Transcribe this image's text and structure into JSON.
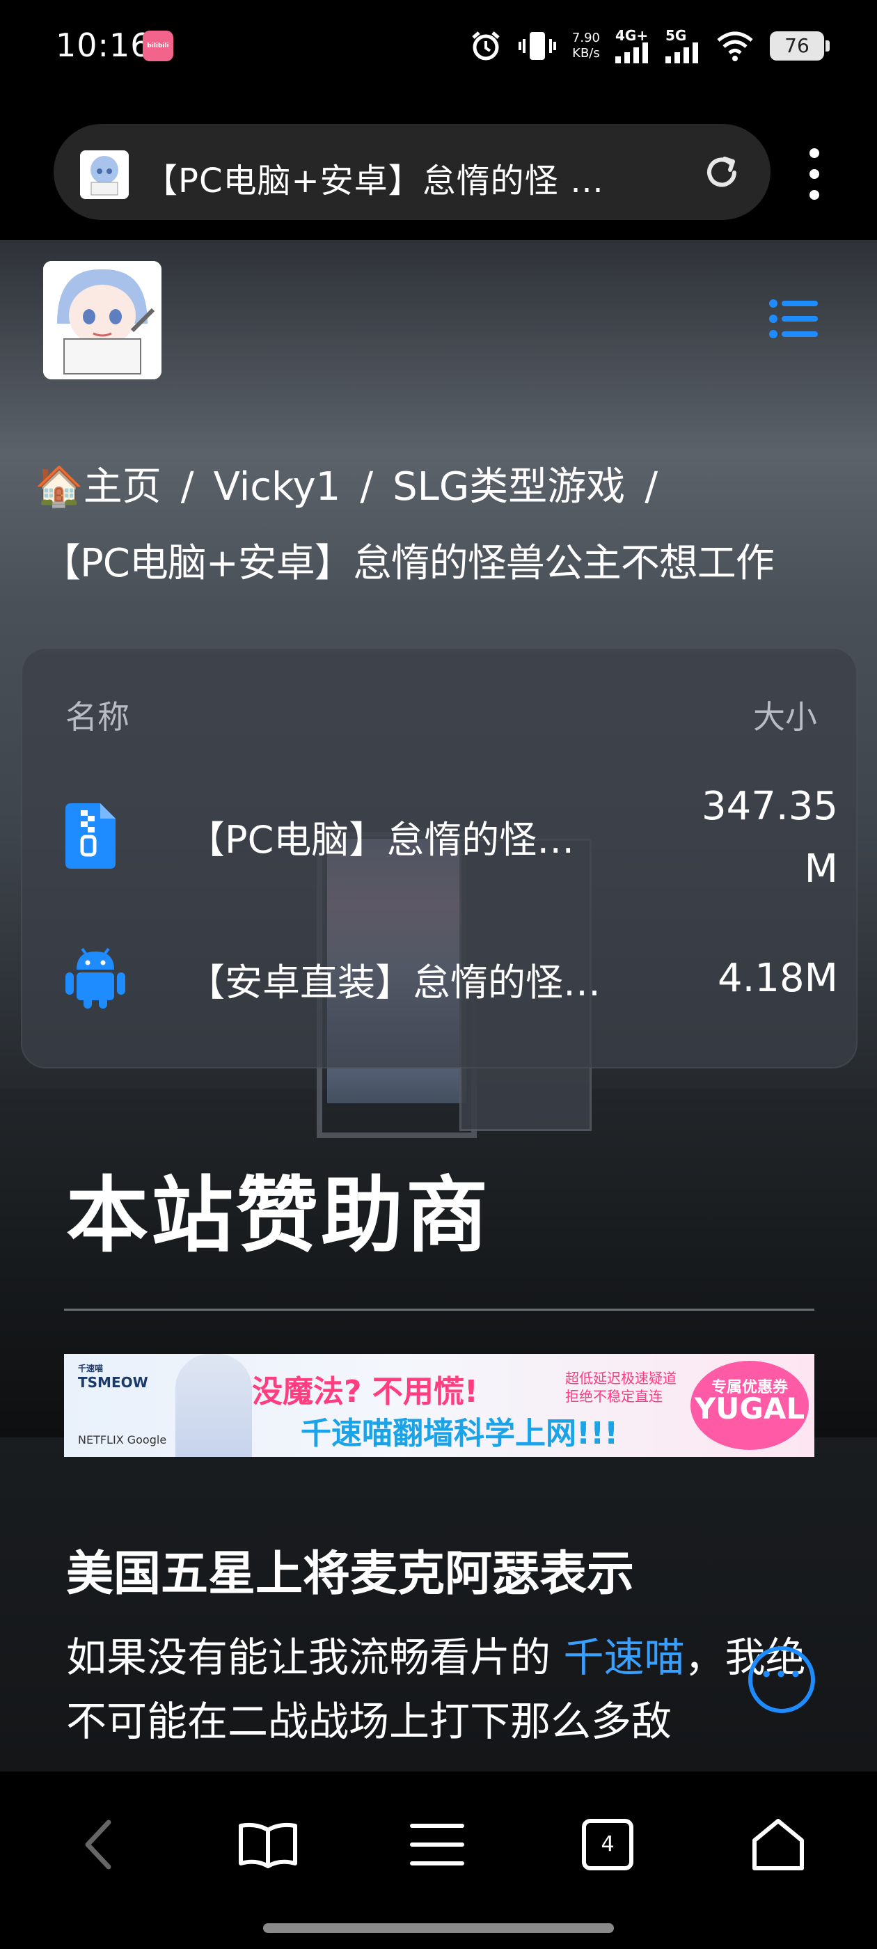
{
  "status": {
    "time": "10:16",
    "app_badge": "bilibili",
    "net_speed_value": "7.90",
    "net_speed_unit": "KB/s",
    "signal1": "4G+",
    "signal2": "5G",
    "battery": "76"
  },
  "browser": {
    "tab_title": "【PC电脑+安卓】怠惰的怪 …"
  },
  "breadcrumb": {
    "home": "主页",
    "items": [
      "Vicky1",
      "SLG类型游戏"
    ],
    "current": "【PC电脑+安卓】怠惰的怪兽公主不想工作"
  },
  "files": {
    "col_name": "名称",
    "col_size": "大小",
    "rows": [
      {
        "name": "【PC电脑】怠惰的怪…",
        "size_line1": "347.35",
        "size_line2": "M",
        "icon": "zip-file-icon"
      },
      {
        "name": "【安卓直装】怠惰的怪…",
        "size_line1": "4.18M",
        "size_line2": "",
        "icon": "android-icon"
      }
    ]
  },
  "sponsor": {
    "title": "本站赞助商",
    "banner": {
      "brand_small": "千速喵",
      "brand": "TSMEOW",
      "main": "没魔法? 不用慌!",
      "sub": "千速喵翻墙科学上网!!!",
      "side_line1": "超低延迟极速疑道",
      "side_line2": "拒绝不稳定直连",
      "badge_top": "专属优惠券",
      "badge_main": "YUGAL",
      "logos": "NETFLIX Google"
    }
  },
  "article": {
    "heading": "美国五星上将麦克阿瑟表示",
    "text_before": "如果没有能让我流畅看片的 ",
    "link": "千速喵",
    "text_after": "，我绝不可能在二战战场上打下那么多敌"
  },
  "bottom_nav": {
    "tab_count": "4"
  },
  "colors": {
    "accent": "#1e8cff",
    "link": "#3aa0ff"
  }
}
